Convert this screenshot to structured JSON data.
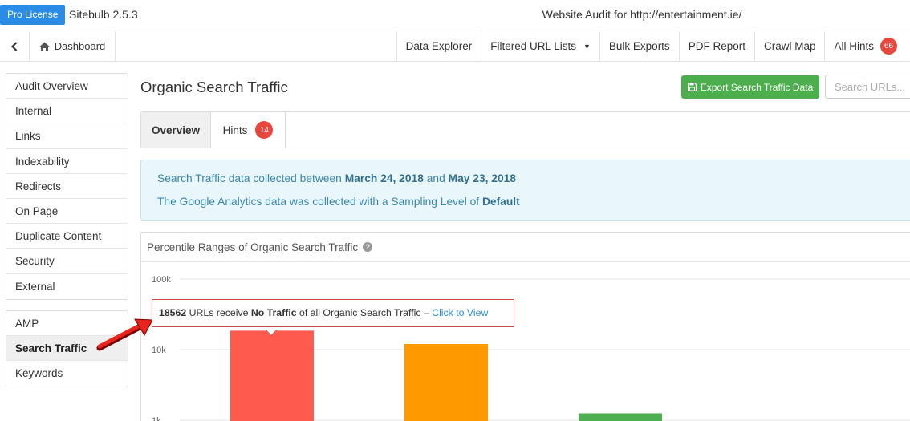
{
  "titlebar": {
    "pro_badge": "Pro License",
    "app_name": "Sitebulb 2.5.3",
    "window_title": "Website Audit for http://entertainment.ie/"
  },
  "navbar": {
    "dashboard_label": "Dashboard",
    "items": [
      {
        "label": "Data Explorer"
      },
      {
        "label": "Filtered URL Lists"
      },
      {
        "label": "Bulk Exports"
      },
      {
        "label": "PDF Report"
      },
      {
        "label": "Crawl Map"
      },
      {
        "label": "All Hints",
        "badge": "66"
      }
    ]
  },
  "sidebar": {
    "group1": [
      "Audit Overview",
      "Internal",
      "Links",
      "Indexability",
      "Redirects",
      "On Page",
      "Duplicate Content",
      "Security",
      "External"
    ],
    "group2": [
      "AMP",
      "Search Traffic",
      "Keywords"
    ],
    "active": "Search Traffic"
  },
  "main": {
    "title": "Organic Search Traffic",
    "export_label": "Export Search Traffic Data",
    "search_placeholder": "Search URLs...",
    "tabs": [
      {
        "label": "Overview"
      },
      {
        "label": "Hints",
        "badge": "14"
      }
    ]
  },
  "info": {
    "line1_prefix": "Search Traffic data collected between",
    "start_date": "March 24, 2018",
    "line1_mid": "and",
    "end_date": "May 23, 2018",
    "line2_prefix": "The Google Analytics data was collected with a Sampling Level of",
    "sampling_level": "Default"
  },
  "chart_panel": {
    "title": "Percentile Ranges of Organic Search Traffic"
  },
  "tooltip": {
    "count": "18562",
    "text1": "URLs receive",
    "bold": "No Traffic",
    "text2": "of all Organic Search Traffic –",
    "link": "Click to View"
  },
  "colors": {
    "accent_blue": "#2b8ce8",
    "export_green": "#4cae4c",
    "badge_red": "#e8473b",
    "bar_red": "#ff5a4e",
    "bar_orange": "#ff9900",
    "bar_green": "#4caf50"
  },
  "chart_data": {
    "type": "bar",
    "yscale": "log",
    "yticks": [
      "100k",
      "10k",
      "1k"
    ],
    "series": [
      {
        "values": [
          18562,
          12000,
          1250
        ]
      }
    ],
    "bar_colors": [
      "#ff5a4e",
      "#ff9900",
      "#4caf50"
    ]
  }
}
